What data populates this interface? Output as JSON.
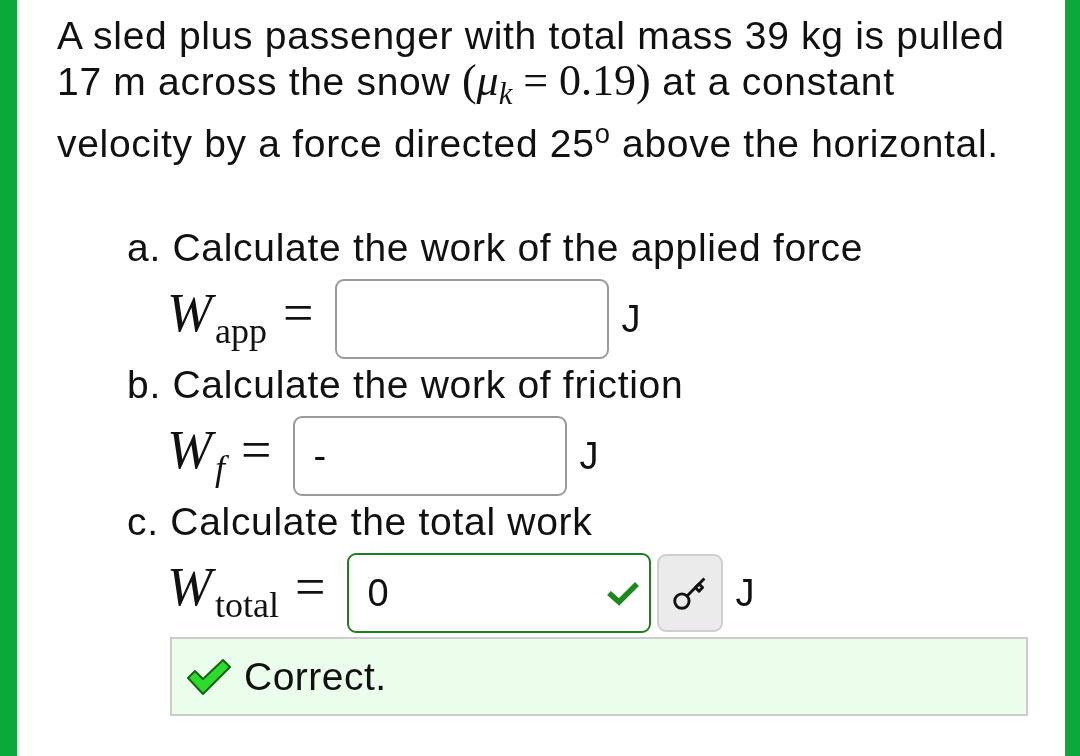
{
  "problem": {
    "segments": [
      {
        "kind": "text",
        "text": "A sled plus passenger with total mass 39 kg is pulled 17 m across the snow "
      },
      {
        "kind": "math",
        "text": "(*μ*$_{k}$ = 0.19)"
      },
      {
        "kind": "text",
        "text": " at a constant velocity by a force directed 25$^{o}$ above the horizontal."
      }
    ]
  },
  "parts": [
    {
      "label": "a. Calculate the work of the applied force",
      "equation": {
        "symbol": "W",
        "subscript": "app",
        "subscript_italic": false,
        "relation": "="
      },
      "answer": {
        "correct": false
      },
      "unit": "J",
      "answer_key_button": false
    },
    {
      "label": "b. Calculate the work of friction",
      "equation": {
        "symbol": "W",
        "subscript": "f",
        "subscript_italic": true,
        "relation": "="
      },
      "answer": {
        "value": "-",
        "correct": false
      },
      "unit": "J",
      "answer_key_button": false
    },
    {
      "label": "c. Calculate the total work",
      "equation": {
        "symbol": "W",
        "subscript": "total",
        "subscript_italic": false,
        "relation": "="
      },
      "answer": {
        "value": "0",
        "correct": true
      },
      "unit": "J",
      "answer_key_button": true
    }
  ],
  "feedback": {
    "kind": "correct",
    "text": "Correct."
  }
}
